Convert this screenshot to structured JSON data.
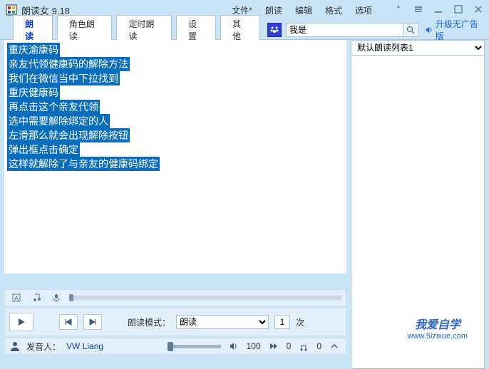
{
  "title": "朗读女 9.18",
  "menu": {
    "file": "文件*",
    "read": "朗读",
    "edit": "编辑",
    "format": "格式",
    "options": "选项"
  },
  "tabs": {
    "read": "朗读",
    "role": "角色朗读",
    "timed": "定时朗读",
    "settings": "设置",
    "other": "其他"
  },
  "search": {
    "value": "我是"
  },
  "upgrade": "升级无广告版",
  "playlist": {
    "selected": "默认朗读列表1"
  },
  "lines": [
    "重庆渝康码",
    "亲友代领健康码的解除方法",
    "我们在微信当中下拉找到",
    "重庆健康码",
    "再点击这个亲友代领",
    "选中需要解除绑定的人",
    "左滑那么就会出现解除按钮",
    "弹出框点击确定",
    "这样就解除了与亲友的健康码绑定"
  ],
  "player": {
    "mode_label": "朗读模式：",
    "mode_value": "朗读",
    "count": "1",
    "count_suffix": "次",
    "voice_label": "发音人：",
    "voice_name": "VW Liang",
    "vol": "100",
    "speed": "0",
    "pitch": "0"
  },
  "watermark": {
    "text": "我爱自学",
    "url": "www.5izixue.com"
  }
}
